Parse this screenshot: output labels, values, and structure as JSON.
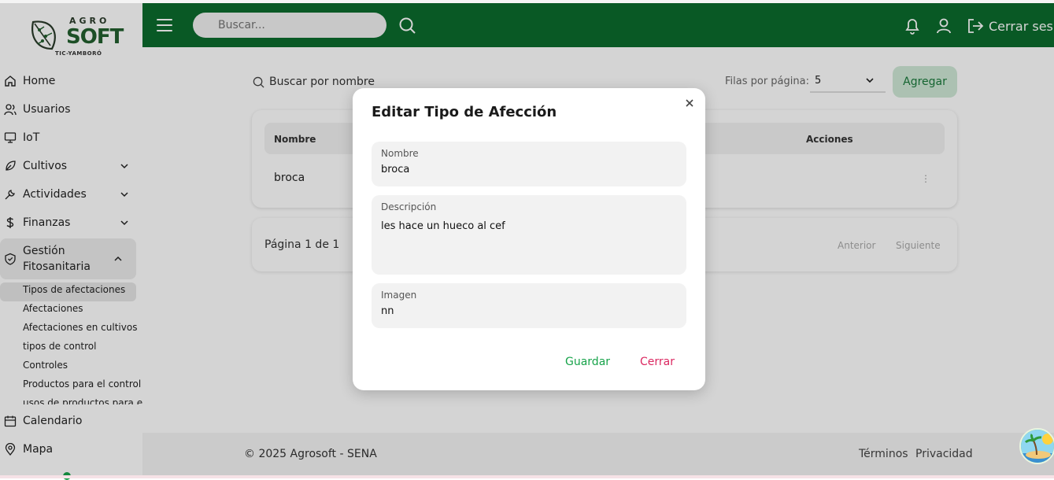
{
  "brand": {
    "agro": "AGRO",
    "soft": "SOFT",
    "tagline": "TIC-YAMBORÓ"
  },
  "header": {
    "search_placeholder": "Buscar...",
    "logout_label": "Cerrar sesió"
  },
  "sidebar": {
    "items": [
      {
        "label": "Home",
        "icon": "home-icon"
      },
      {
        "label": "Usuarios",
        "icon": "users-icon"
      },
      {
        "label": "IoT",
        "icon": "monitor-icon"
      },
      {
        "label": "Cultivos",
        "icon": "leaf-icon"
      },
      {
        "label": "Actividades",
        "icon": "wrench-icon"
      },
      {
        "label": "Finanzas",
        "icon": "dollar-icon"
      },
      {
        "label": "Gestión Fitosanitaria",
        "label_line1": "Gestión",
        "label_line2": "Fitosanitaria",
        "icon": "shield-icon"
      },
      {
        "label": "Calendario",
        "icon": "calendar-icon"
      },
      {
        "label": "Mapa",
        "icon": "map-pin-icon"
      }
    ],
    "subitems": [
      "Tipos de afectaciones",
      "Afectaciones",
      "Afectaciones en cultivos",
      "tipos de control",
      "Controles",
      "Productos para el control",
      "usos de productos para el"
    ]
  },
  "main": {
    "search_placeholder": "Buscar por nombre",
    "rows_per_page_label": "Filas por página:",
    "rows_per_page_value": "5",
    "add_label": "Agregar",
    "table": {
      "columns": [
        "Nombre",
        "Acciones"
      ],
      "rows": [
        {
          "nombre": "broca",
          "acciones": "⋮"
        }
      ]
    },
    "pagination": {
      "text": "Página 1 de 1",
      "prev": "Anterior",
      "next": "Siguiente"
    }
  },
  "footer": {
    "copyright": "© 2025 Agrosoft - SENA",
    "terms": "Términos",
    "privacy": "Privacidad"
  },
  "modal": {
    "title": "Editar Tipo de Afección",
    "fields": {
      "nombre": {
        "label": "Nombre",
        "value": "broca"
      },
      "descripcion": {
        "label": "Descripción",
        "value": "les hace un hueco al cef"
      },
      "imagen": {
        "label": "Imagen",
        "value": "nn"
      }
    },
    "save_label": "Guardar",
    "close_label": "Cerrar"
  },
  "colors": {
    "header": "#0b6b2d",
    "accent_green": "#17a34a",
    "close_red": "#db2760",
    "add_button_bg": "#cfe9d6"
  }
}
